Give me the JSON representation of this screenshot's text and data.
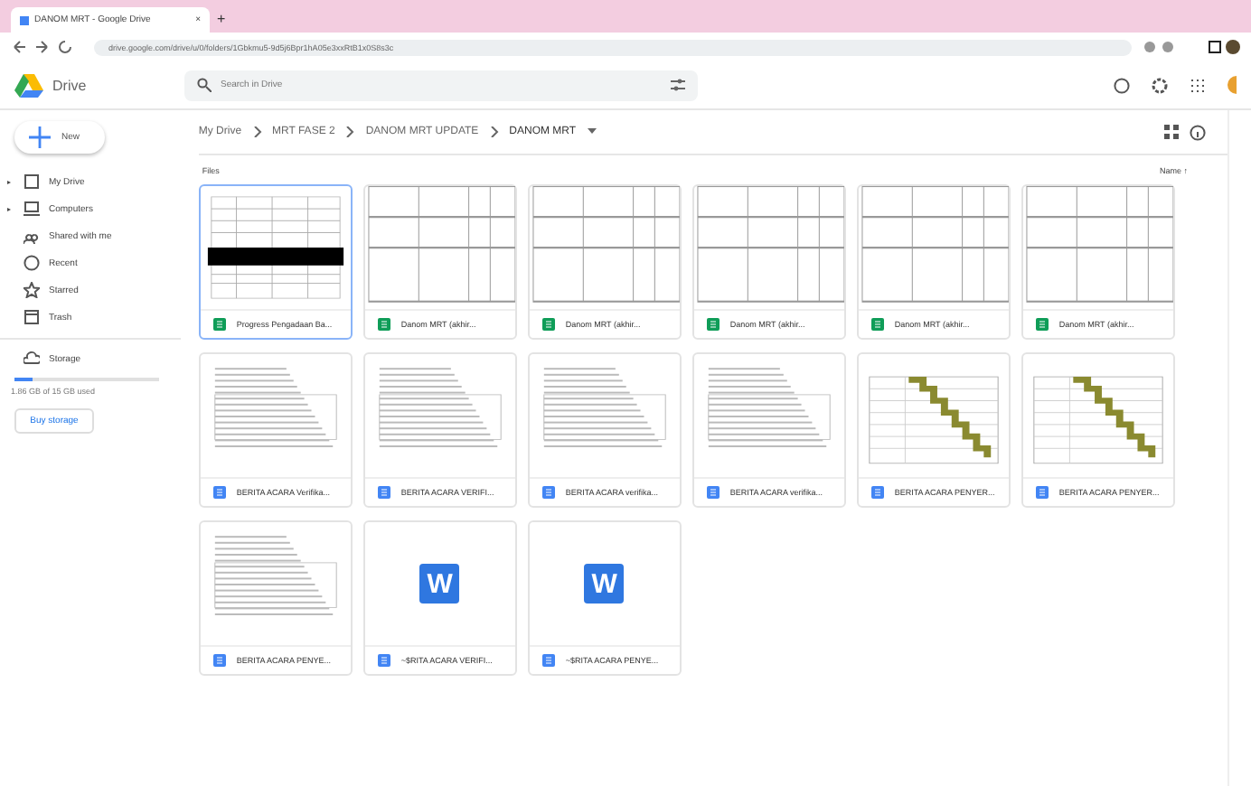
{
  "browser": {
    "tab_title": "DANOM MRT - Google Drive",
    "tab_close": "×",
    "new_tab": "+",
    "url": "drive.google.com/drive/u/0/folders/1Gbkmu5-9d5j6Bpr1hA05e3xxRtB1x0S8s3c"
  },
  "header": {
    "product": "Drive",
    "search": {
      "placeholder": "Search in Drive"
    }
  },
  "sidebar": {
    "new_button": "New",
    "items": [
      {
        "label": "My Drive",
        "expander": "▸",
        "selected": false
      },
      {
        "label": "Computers",
        "expander": "▸",
        "selected": false
      },
      {
        "label": "Shared with me",
        "selected": false
      },
      {
        "label": "Recent",
        "selected": false
      },
      {
        "label": "Starred",
        "selected": false
      },
      {
        "label": "Trash",
        "selected": false
      }
    ],
    "storage": {
      "label": "Storage",
      "level": 0.12,
      "usage": "1.86 GB of 15 GB used",
      "buy": "Buy storage"
    }
  },
  "breadcrumb": [
    "My Drive",
    "MRT FASE 2",
    "DANOM MRT UPDATE",
    "DANOM MRT"
  ],
  "files_label": "Files",
  "sort": "Name ↑",
  "files": [
    {
      "name": "Progress Pengadaan Ba...",
      "kind": "sheet",
      "selected": true
    },
    {
      "name": "Danom MRT (akhir...",
      "kind": "sheet",
      "selected": false
    },
    {
      "name": "Danom MRT (akhir...",
      "kind": "sheet",
      "selected": false
    },
    {
      "name": "Danom MRT (akhir...",
      "kind": "sheet",
      "selected": false
    },
    {
      "name": "Danom MRT (akhir...",
      "kind": "sheet",
      "selected": false
    },
    {
      "name": "Danom MRT (akhir...",
      "kind": "sheet",
      "selected": false
    },
    {
      "name": "BERITA ACARA Verifika...",
      "kind": "doc",
      "selected": false
    },
    {
      "name": "BERITA ACARA VERIFI...",
      "kind": "doc",
      "selected": false
    },
    {
      "name": "BERITA ACARA verifika...",
      "kind": "doc",
      "selected": false
    },
    {
      "name": "BERITA ACARA verifika...",
      "kind": "doc",
      "selected": false
    },
    {
      "name": "BERITA ACARA PENYER...",
      "kind": "doc",
      "selected": false
    },
    {
      "name": "BERITA ACARA PENYER...",
      "kind": "doc",
      "selected": false
    },
    {
      "name": "BERITA ACARA PENYE...",
      "kind": "doc",
      "selected": false
    },
    {
      "name": "~$RITA ACARA VERIFI...",
      "kind": "doc",
      "letter": "W",
      "selected": false
    },
    {
      "name": "~$RITA ACARA PENYE...",
      "kind": "doc",
      "letter": "W",
      "selected": false
    }
  ]
}
